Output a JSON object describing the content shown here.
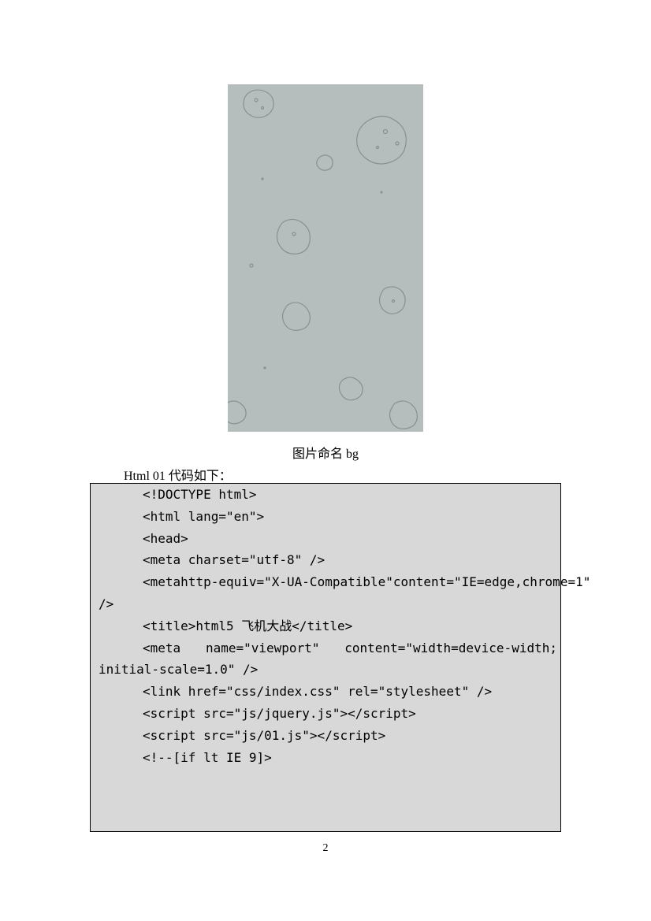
{
  "caption": "图片命名 bg",
  "code_intro": "Html 01 代码如下：",
  "code": {
    "lines": [
      "<!DOCTYPE html>",
      "<html lang=\"en\">",
      "<head>",
      "<meta charset=\"utf-8\" />"
    ],
    "wrap1_parts": [
      "<meta",
      "http-equiv=\"X-UA-Compatible\"",
      "content=\"IE=edge,chrome=1\""
    ],
    "wrap1_cont": "/>",
    "line_title": "<title>html5 飞机大战</title>",
    "wrap2_parts": [
      "<meta",
      "name=\"viewport\"",
      "content=\"width=device-width;"
    ],
    "wrap2_cont": "initial-scale=1.0\" />",
    "line_link": "<link href=\"css/index.css\" rel=\"stylesheet\" />",
    "blank": "",
    "line_jq": "<script src=\"js/jquery.js\"></script>",
    "line_01": "<script src=\"js/01.js\"></script>",
    "line_if": "<!--[if lt IE 9]>"
  },
  "page_number": "2"
}
